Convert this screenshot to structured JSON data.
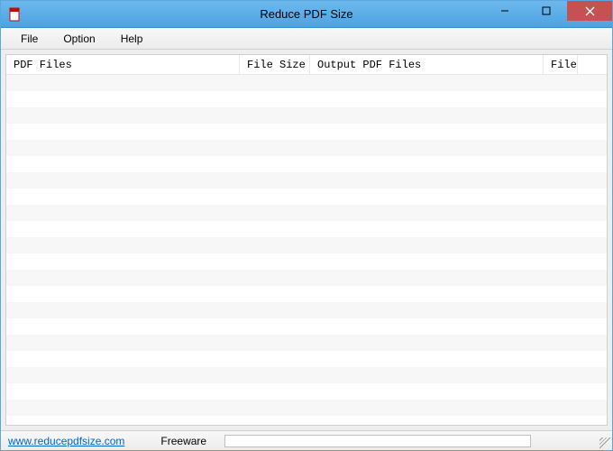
{
  "titlebar": {
    "title": "Reduce PDF Size"
  },
  "menubar": {
    "items": [
      {
        "label": "File"
      },
      {
        "label": "Option"
      },
      {
        "label": "Help"
      }
    ]
  },
  "table": {
    "columns": [
      {
        "label": "PDF Files"
      },
      {
        "label": "File Size"
      },
      {
        "label": "Output PDF Files"
      },
      {
        "label": "File Size"
      },
      {
        "label": ""
      }
    ]
  },
  "statusbar": {
    "link": "www.reducepdfsize.com",
    "license": "Freeware"
  }
}
